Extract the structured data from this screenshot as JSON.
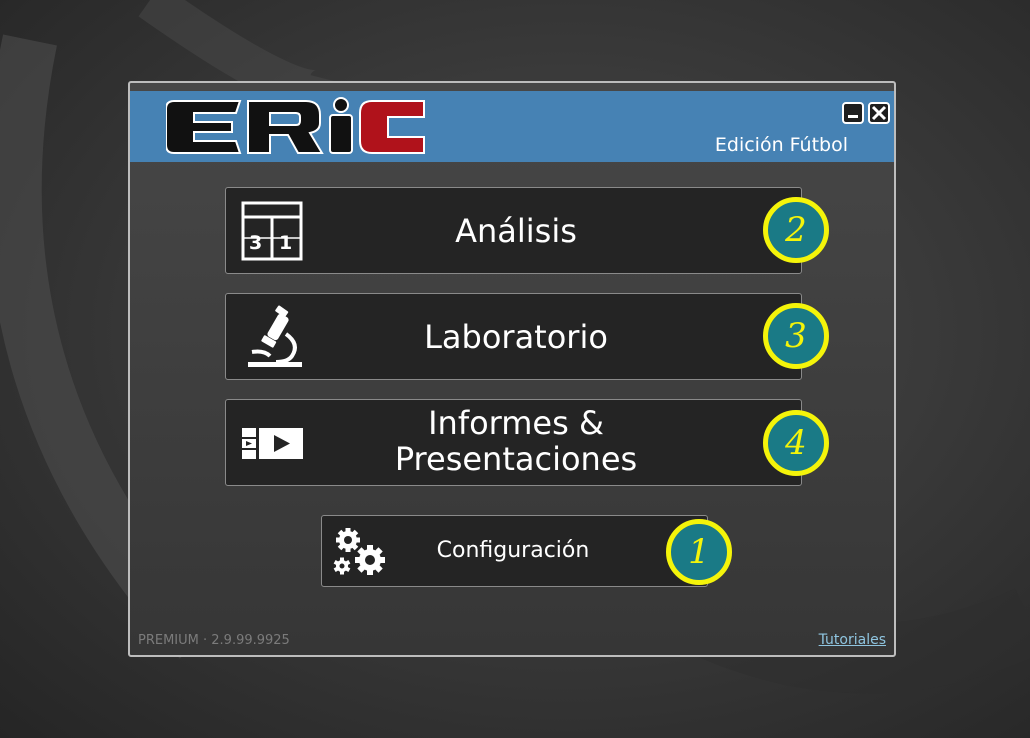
{
  "window": {
    "edition_label": "Edición Fútbol",
    "logo_text": "ERIC",
    "minimize_icon": "minimize-icon",
    "close_icon": "close-icon"
  },
  "menu": [
    {
      "label": "Análisis",
      "icon": "scoreboard-icon",
      "badge": "2"
    },
    {
      "label": "Laboratorio",
      "icon": "microscope-icon",
      "badge": "3"
    },
    {
      "label_line1": "Informes &",
      "label_line2": "Presentaciones",
      "icon": "video-player-icon",
      "badge": "4"
    }
  ],
  "config": {
    "label": "Configuración",
    "icon": "gears-icon",
    "badge": "1"
  },
  "footer": {
    "version": "PREMIUM · 2.9.99.9925",
    "tutorials_link": "Tutoriales"
  },
  "colors": {
    "header": "#4682b4",
    "badge_fill": "#1a7a86",
    "badge_ring": "#f4f40a",
    "logo_red": "#b0121b"
  }
}
